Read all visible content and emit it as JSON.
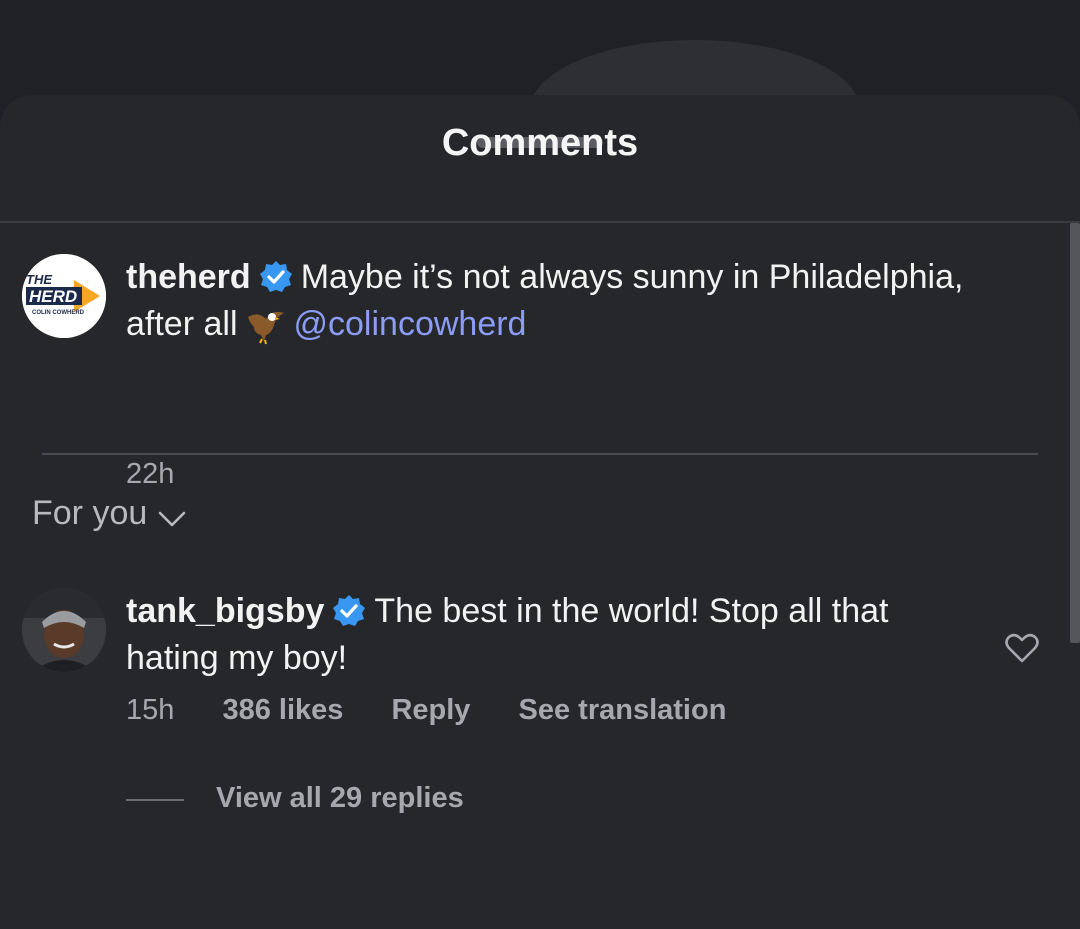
{
  "sheet": {
    "title": "Comments"
  },
  "post_caption": {
    "username": "theherd",
    "text_line": "Maybe it’s not always sunny in Philadelphia,",
    "text_continued": "after all",
    "mention": "@colincowherd",
    "time": "22h",
    "avatar_logo": {
      "top": "THE",
      "main": "HERD",
      "sub": "COLIN COWHERD"
    }
  },
  "filter": {
    "label": "For you"
  },
  "comments": [
    {
      "username": "tank_bigsby",
      "text_line1": "The best in the world! Stop all that",
      "text_line2": "hating my boy!",
      "time": "15h",
      "likes": "386 likes",
      "reply_label": "Reply",
      "translate_label": "See translation",
      "view_replies": "View all 29 replies"
    }
  ],
  "icons": {
    "verified": "verified-badge-icon",
    "eagle": "eagle-emoji-icon",
    "chevron": "chevron-down-icon",
    "heart": "heart-icon"
  },
  "colors": {
    "sheet_bg": "#26272b",
    "mention": "#8b9cf7",
    "verified": "#3897f0",
    "muted_text": "#a7a8ad"
  }
}
